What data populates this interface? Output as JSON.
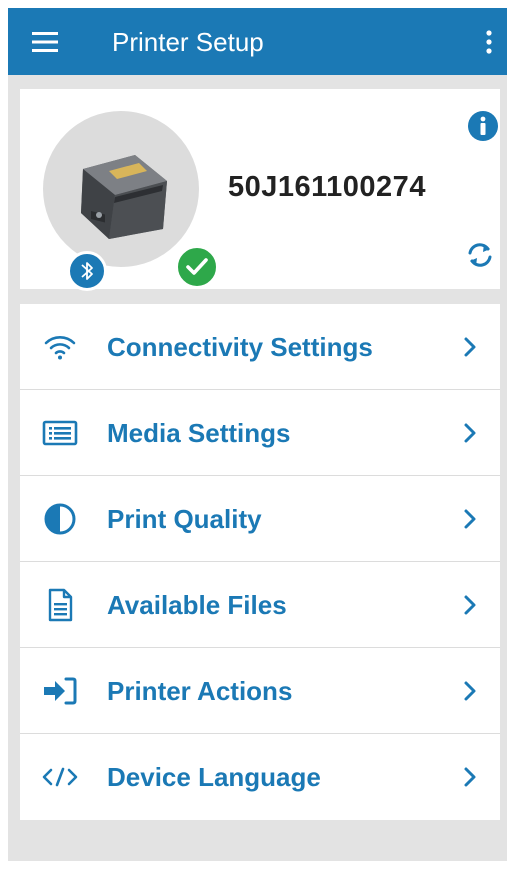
{
  "appbar": {
    "title": "Printer Setup",
    "background_color": "#1b79b5"
  },
  "printer": {
    "serial": "50J161100274",
    "connection": "bluetooth-icon",
    "status": "connected-check-icon",
    "status_color": "#2ea84a"
  },
  "menu": {
    "items": [
      {
        "label": "Connectivity Settings",
        "icon": "wifi-icon"
      },
      {
        "label": "Media Settings",
        "icon": "media-list-icon"
      },
      {
        "label": "Print Quality",
        "icon": "contrast-icon"
      },
      {
        "label": "Available Files",
        "icon": "file-icon"
      },
      {
        "label": "Printer Actions",
        "icon": "sign-in-icon"
      },
      {
        "label": "Device Language",
        "icon": "code-icon"
      }
    ],
    "label_color": "#1b79b5"
  }
}
